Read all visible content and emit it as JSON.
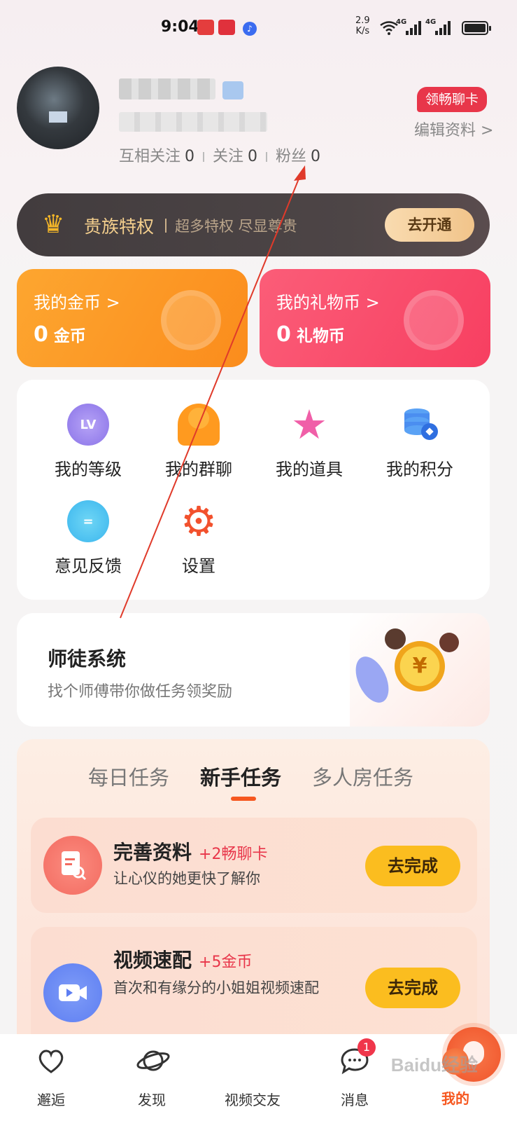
{
  "status_bar": {
    "time": "9:04",
    "network_speed_value": "2.9",
    "network_speed_unit": "K/s",
    "sim1_label": "4G",
    "sim2_label": "4G"
  },
  "profile": {
    "following_mutual_label": "互相关注",
    "following_mutual_count": "0",
    "following_label": "关注",
    "following_count": "0",
    "fans_label": "粉丝",
    "fans_count": "0",
    "chat_card_badge": "领畅聊卡",
    "edit_profile_label": "编辑资料 >"
  },
  "vip": {
    "title": "贵族特权",
    "subtitle": "超多特权 尽显尊贵",
    "button_label": "去开通"
  },
  "coins": {
    "gold": {
      "title": "我的金币 >",
      "value": "0",
      "unit": "金币"
    },
    "gift": {
      "title": "我的礼物币 >",
      "value": "0",
      "unit": "礼物币"
    }
  },
  "grid": {
    "items": [
      {
        "label": "我的等级",
        "icon": "lv-badge-icon",
        "icon_text": "LV"
      },
      {
        "label": "我的群聊",
        "icon": "group-chat-icon"
      },
      {
        "label": "我的道具",
        "icon": "star-icon"
      },
      {
        "label": "我的积分",
        "icon": "points-database-icon"
      },
      {
        "label": "意见反馈",
        "icon": "feedback-bubble-icon"
      },
      {
        "label": "设置",
        "icon": "gear-icon"
      }
    ]
  },
  "mentor": {
    "title": "师徒系统",
    "subtitle": "找个师傅带你做任务领奖励",
    "coin_symbol": "¥"
  },
  "tasks": {
    "tabs": [
      "每日任务",
      "新手任务",
      "多人房任务"
    ],
    "active_tab": "新手任务",
    "items": [
      {
        "title": "完善资料",
        "reward": "+2畅聊卡",
        "desc": "让心仪的她更快了解你",
        "button": "去完成",
        "icon": "profile-document-icon"
      },
      {
        "title": "视频速配",
        "reward": "+5金币",
        "desc": "首次和有缘分的小姐姐视频速配",
        "button": "去完成",
        "icon": "video-camera-icon"
      }
    ]
  },
  "bottom_nav": {
    "items": [
      {
        "label": "邂逅",
        "icon": "heart-icon"
      },
      {
        "label": "发现",
        "icon": "planet-icon"
      },
      {
        "label": "视频交友",
        "icon": "video-match-icon"
      },
      {
        "label": "消息",
        "icon": "message-icon",
        "badge": "1"
      },
      {
        "label": "我的",
        "icon": "profile-icon"
      }
    ],
    "active": "我的"
  },
  "watermark": "Baidu经验",
  "colors": {
    "accent": "#f6571f",
    "gold_card": "#fd9a26",
    "gift_card": "#f94a69",
    "task_button": "#fbbd1f",
    "badge_red": "#e8364a"
  }
}
